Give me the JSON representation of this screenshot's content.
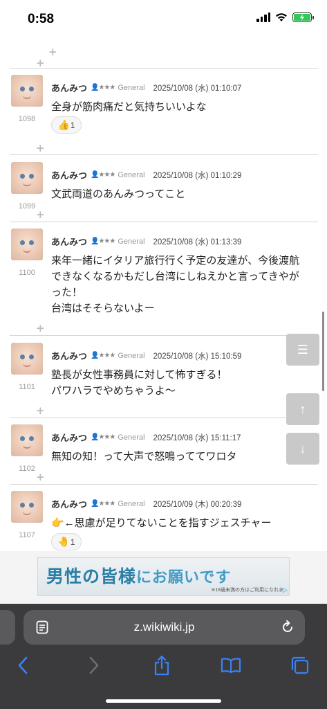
{
  "status": {
    "time": "0:58"
  },
  "posts": [
    {
      "num": "1098",
      "name": "あんみつ",
      "rank": "★★★",
      "grade": "General",
      "date": "2025/10/08 (水) 01:10:07",
      "body": "全身が筋肉痛だと気持ちいいよな",
      "reaction_emoji": "👍",
      "reaction_count": "1"
    },
    {
      "num": "1099",
      "name": "あんみつ",
      "rank": "★★★",
      "grade": "General",
      "date": "2025/10/08 (水) 01:10:29",
      "body": "文武両道のあんみつってこと"
    },
    {
      "num": "1100",
      "name": "あんみつ",
      "rank": "★★★",
      "grade": "General",
      "date": "2025/10/08 (水) 01:13:39",
      "body_lines": [
        "来年一緒にイタリア旅行行く予定の友達が、今後渡航",
        "できなくなるかもだし台湾にしねえかと言ってきやが",
        "った！",
        "台湾はそそらないよー"
      ]
    },
    {
      "num": "1101",
      "name": "あんみつ",
      "rank": "★★★",
      "grade": "General",
      "date": "2025/10/08 (水) 15:10:59",
      "body_lines": [
        "塾長が女性事務員に対して怖すぎる！",
        "パワハラでやめちゃうよ〜"
      ]
    },
    {
      "num": "1102",
      "name": "あんみつ",
      "rank": "★★★",
      "grade": "General",
      "date": "2025/10/08 (水) 15:11:17",
      "body": "無知の知！って大声で怒鳴っててワロタ"
    },
    {
      "num": "1107",
      "name": "あんみつ",
      "rank": "★★★",
      "grade": "General",
      "date": "2025/10/09 (木) 00:20:39",
      "body": "👉←思慮が足りてないことを指すジェスチャー",
      "reaction_emoji": "🤚",
      "reaction_count": "1"
    }
  ],
  "plus_sign": "+",
  "fabs": {
    "menu": "☰",
    "up": "↑",
    "down": "↓"
  },
  "ad": {
    "main_1": "男性の皆様",
    "main_2": "にお願いです",
    "sub": "※18歳未満の方はご利用になれま"
  },
  "browser": {
    "url": "z.wikiwiki.jp"
  },
  "colors": {
    "browser_bar": "#3b3b3d",
    "url_field": "#5a5a5d",
    "ios_blue": "#3a82f7",
    "ad_text": "#2a7ea5",
    "fab": "#c9c9c9"
  }
}
